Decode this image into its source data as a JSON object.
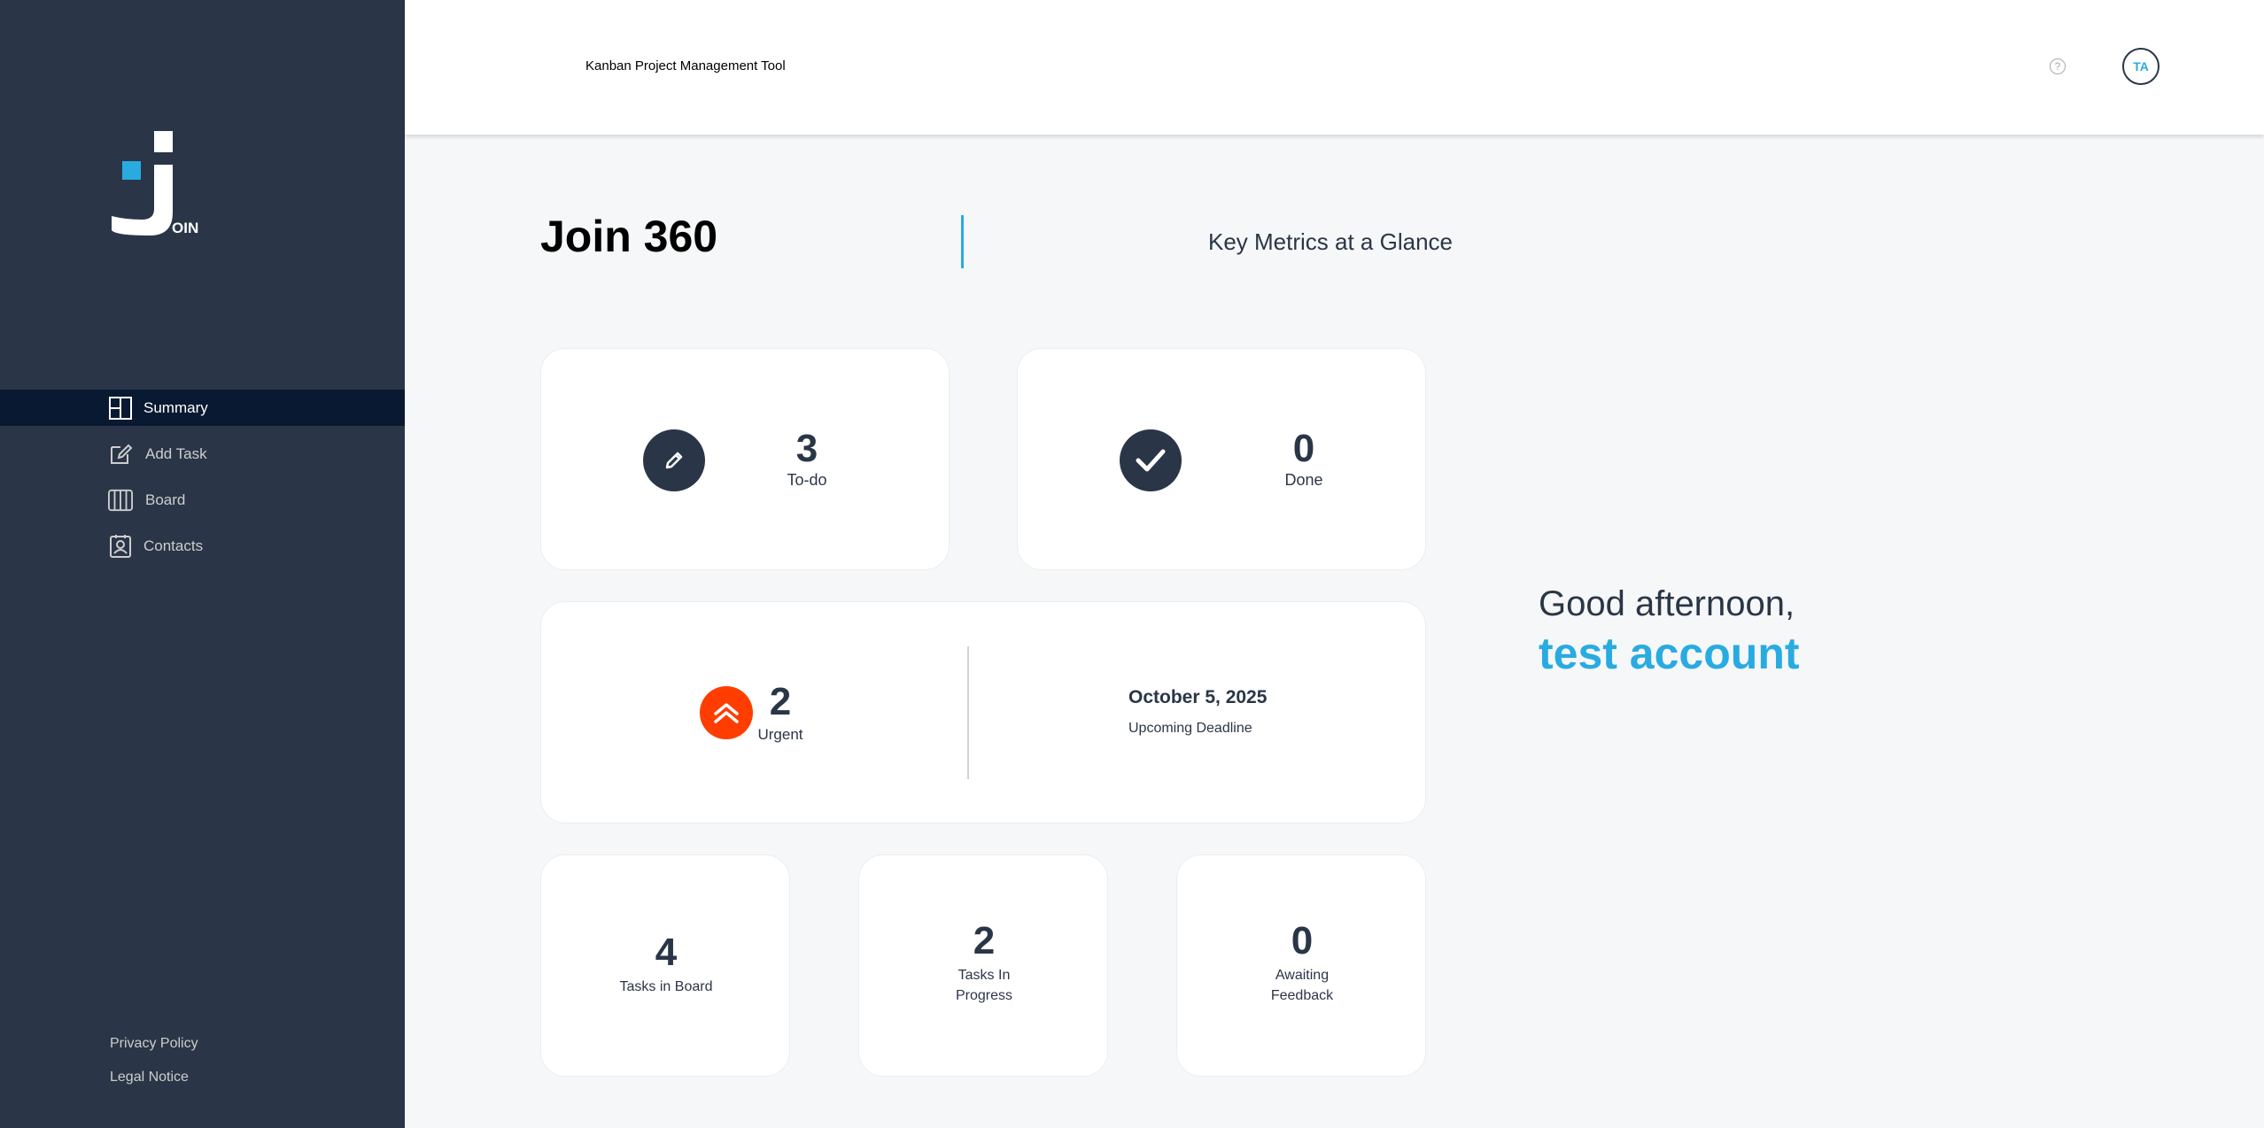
{
  "sidebar": {
    "logo_text": "OIN",
    "items": [
      {
        "label": "Summary",
        "icon": "summary-icon"
      },
      {
        "label": "Add Task",
        "icon": "add-task-icon"
      },
      {
        "label": "Board",
        "icon": "board-icon"
      },
      {
        "label": "Contacts",
        "icon": "contacts-icon"
      }
    ],
    "footer": [
      "Privacy Policy",
      "Legal Notice"
    ]
  },
  "header": {
    "title": "Kanban Project Management Tool",
    "help": "?",
    "avatar_initials": "TA"
  },
  "main": {
    "title": "Join 360",
    "subtitle": "Key Metrics at a Glance",
    "todo": {
      "count": "3",
      "label": "To-do"
    },
    "done": {
      "count": "0",
      "label": "Done"
    },
    "urgent": {
      "count": "2",
      "label": "Urgent"
    },
    "deadline": {
      "date": "October 5, 2025",
      "label": "Upcoming Deadline"
    },
    "board": {
      "count": "4",
      "label": "Tasks in Board"
    },
    "progress": {
      "count": "2",
      "label_line1": "Tasks In",
      "label_line2": "Progress"
    },
    "feedback": {
      "count": "0",
      "label_line1": "Awaiting",
      "label_line2": "Feedback"
    }
  },
  "greeting": {
    "text": "Good afternoon,",
    "name": "test account"
  },
  "colors": {
    "sidebar": "#2A3647",
    "active_nav": "#091931",
    "accent": "#29ABE2",
    "urgent": "#FF3D00",
    "background": "#F6F7F8"
  }
}
